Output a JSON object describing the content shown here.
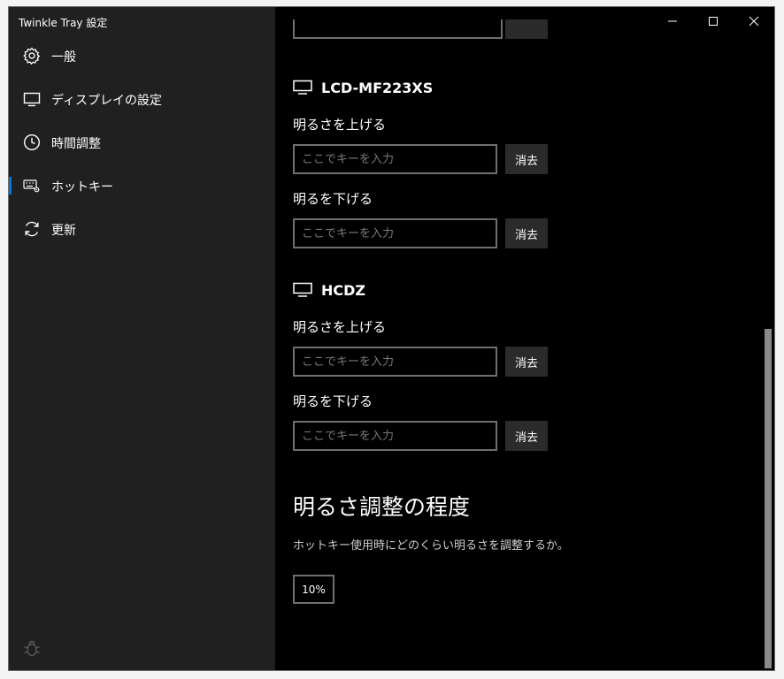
{
  "window": {
    "title": "Twinkle Tray 設定"
  },
  "sidebar": {
    "items": [
      {
        "label": "一般",
        "icon": "gear-icon"
      },
      {
        "label": "ディスプレイの設定",
        "icon": "monitor-icon"
      },
      {
        "label": "時間調整",
        "icon": "clock-icon"
      },
      {
        "label": "ホットキー",
        "icon": "keyboard-gear-icon",
        "active": true
      },
      {
        "label": "更新",
        "icon": "refresh-icon"
      }
    ],
    "accent_color": "#0078d4"
  },
  "monitors": [
    {
      "name": "LCD-MF223XS",
      "increase_label": "明るさを上げる",
      "decrease_label": "明るを下げる",
      "increase_value": "",
      "decrease_value": "",
      "placeholder": "ここでキーを入力",
      "clear_label": "消去"
    },
    {
      "name": "HCDZ",
      "increase_label": "明るさを上げる",
      "decrease_label": "明るを下げる",
      "increase_value": "",
      "decrease_value": "",
      "placeholder": "ここでキーを入力",
      "clear_label": "消去"
    }
  ],
  "brightness_step": {
    "title": "明るさ調整の程度",
    "description": "ホットキー使用時にどのくらい明るさを調整するか。",
    "value": "10%"
  }
}
